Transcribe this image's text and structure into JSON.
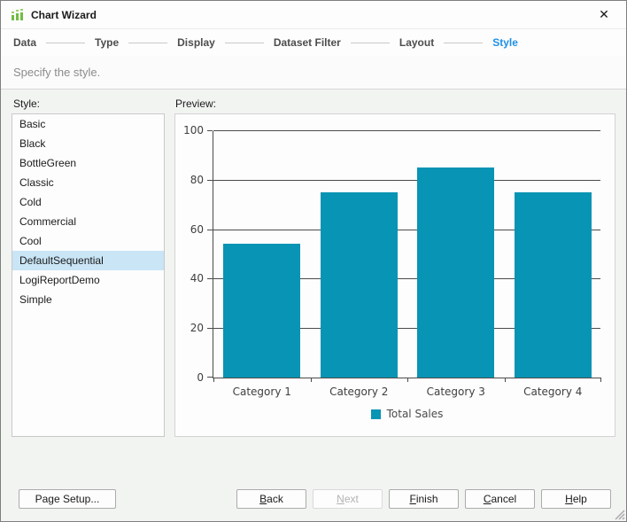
{
  "window": {
    "title": "Chart Wizard",
    "close_glyph": "✕"
  },
  "steps": [
    {
      "label": "Data",
      "active": false
    },
    {
      "label": "Type",
      "active": false
    },
    {
      "label": "Display",
      "active": false
    },
    {
      "label": "Dataset Filter",
      "active": false
    },
    {
      "label": "Layout",
      "active": false
    },
    {
      "label": "Style",
      "active": true
    }
  ],
  "subtitle": "Specify the style.",
  "style_panel": {
    "label": "Style:",
    "items": [
      "Basic",
      "Black",
      "BottleGreen",
      "Classic",
      "Cold",
      "Commercial",
      "Cool",
      "DefaultSequential",
      "LogiReportDemo",
      "Simple"
    ],
    "selected": "DefaultSequential"
  },
  "preview_panel": {
    "label": "Preview:"
  },
  "chart_data": {
    "type": "bar",
    "categories": [
      "Category 1",
      "Category 2",
      "Category 3",
      "Category 4"
    ],
    "series": [
      {
        "name": "Total Sales",
        "values": [
          54,
          75,
          85,
          75
        ]
      }
    ],
    "title": "",
    "xlabel": "",
    "ylabel": "",
    "ylim": [
      0,
      100
    ],
    "yticks": [
      0,
      20,
      40,
      60,
      80,
      100
    ],
    "grid": true,
    "legend_position": "bottom",
    "bar_color": "#0894b4"
  },
  "footer": {
    "page_setup": {
      "label": "Page Setup..."
    },
    "buttons": [
      {
        "label": "Back",
        "underline": 0,
        "disabled": false
      },
      {
        "label": "Next",
        "underline": 0,
        "disabled": true
      },
      {
        "label": "Finish",
        "underline": 0,
        "disabled": false
      },
      {
        "label": "Cancel",
        "underline": 0,
        "disabled": false
      },
      {
        "label": "Help",
        "underline": 0,
        "disabled": false
      }
    ]
  },
  "colors": {
    "accent_blue": "#1e8fe8",
    "bar_teal": "#0894b4",
    "selection_bg": "#c9e5f6",
    "gridline": "#4b4b4b",
    "icon_green": "#72bc44"
  }
}
